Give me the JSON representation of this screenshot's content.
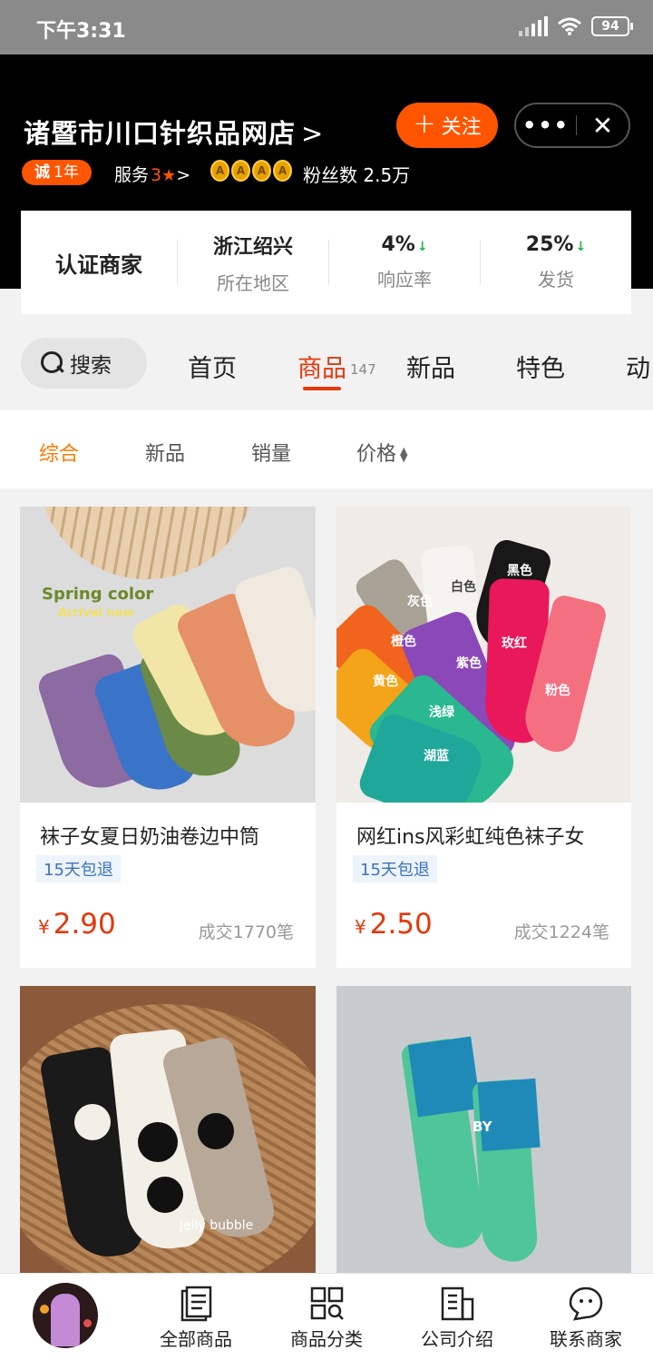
{
  "status_bar": {
    "time": "下午3:31",
    "battery": "94"
  },
  "store": {
    "name": "诸暨市川口针织品网店",
    "follow_label": "关注",
    "cheng_char": "诚",
    "years": "1年",
    "service_label": "服务",
    "service_score": "3",
    "crown_char": "A",
    "fans": "粉丝数 2.5万"
  },
  "info": {
    "certified": "认证商家",
    "location_value": "浙江绍兴",
    "location_label": "所在地区",
    "response_value": "4%",
    "response_label": "响应率",
    "shipping_value": "25%",
    "shipping_label": "发货"
  },
  "nav": {
    "search": "搜索",
    "tabs": [
      "首页",
      "商品",
      "新品",
      "特色",
      "动"
    ],
    "product_count": "147"
  },
  "sort": {
    "items": [
      "综合",
      "新品",
      "销量",
      "价格"
    ]
  },
  "products": [
    {
      "title": "袜子女夏日奶油卷边中筒",
      "tag": "15天包退",
      "yen": "¥",
      "price": "2.90",
      "sales": "成交1770笔",
      "image_text_1": "Spring color",
      "image_text_2": "Arrival new"
    },
    {
      "title": "网红ins风彩虹纯色袜子女",
      "tag": "15天包退",
      "yen": "¥",
      "price": "2.50",
      "sales": "成交1224笔",
      "color_labels": [
        "灰色",
        "白色",
        "黑色",
        "橙色",
        "紫色",
        "玫红",
        "黄色",
        "浅绿",
        "粉色",
        "湖蓝"
      ]
    },
    {
      "image_text": "Jelly bubble"
    },
    {
      "image_text": "BY"
    }
  ],
  "bottom_nav": {
    "items": [
      "全部商品",
      "商品分类",
      "公司介绍",
      "联系商家"
    ]
  },
  "colors": {
    "accent": "#ff5500",
    "active_tab": "#e4380c",
    "price": "#e4380c",
    "sort_active": "#ff7a00",
    "header_bg": "#000000"
  }
}
